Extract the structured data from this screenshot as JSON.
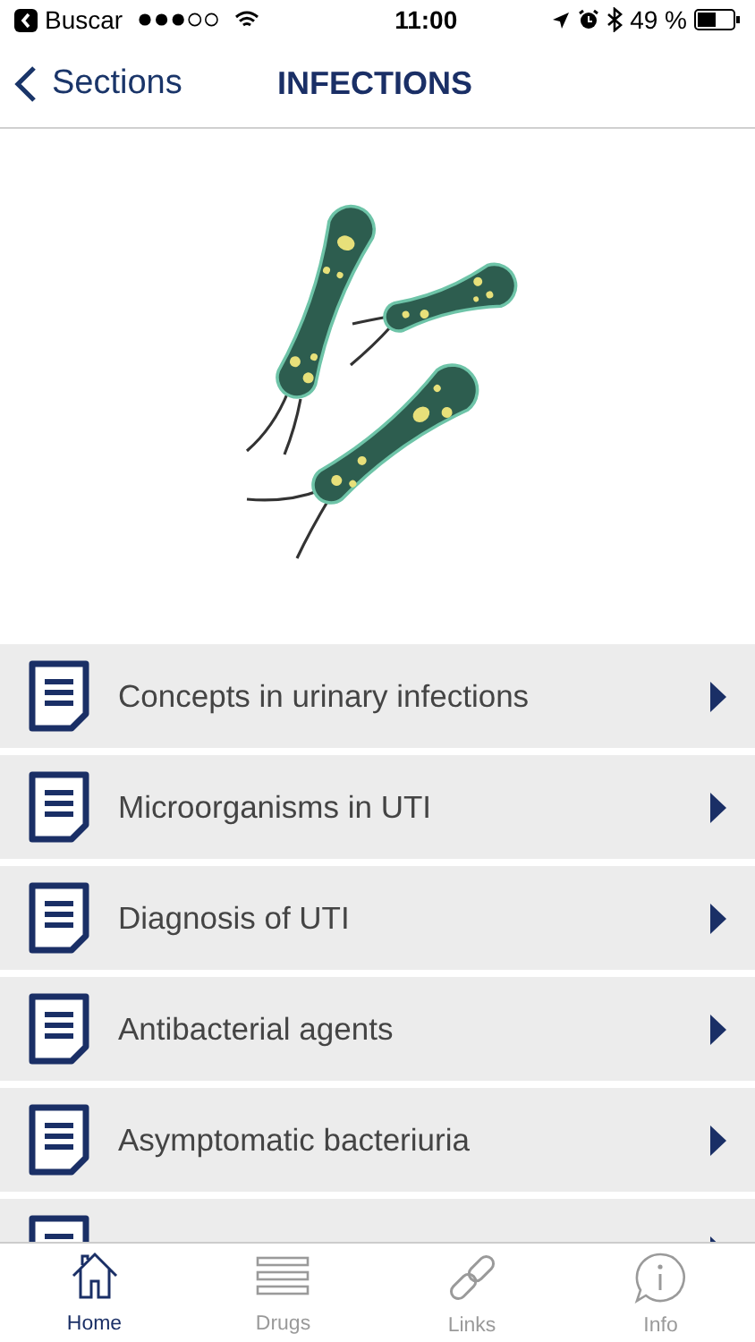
{
  "status_bar": {
    "back_app": "Buscar",
    "time": "11:00",
    "battery": "49 %"
  },
  "nav_bar": {
    "back": "Sections",
    "title": "INFECTIONS"
  },
  "sections": [
    {
      "kind": "document",
      "title": "Concepts in urinary infections"
    },
    {
      "kind": "document",
      "title": "Microorganisms in UTI"
    },
    {
      "kind": "document",
      "title": "Diagnosis of UTI"
    },
    {
      "kind": "document",
      "title": "Antibacterial agents"
    },
    {
      "kind": "document",
      "title": "Asymptomatic bacteriuria"
    },
    {
      "kind": "document"
    }
  ],
  "tab_bar": [
    {
      "label": "Home",
      "kind": "home",
      "selected": true
    },
    {
      "label": "Drugs",
      "kind": "drugs",
      "selected": false
    },
    {
      "label": "Links",
      "kind": "links",
      "selected": false
    },
    {
      "label": "Info",
      "kind": "info",
      "selected": false
    }
  ]
}
